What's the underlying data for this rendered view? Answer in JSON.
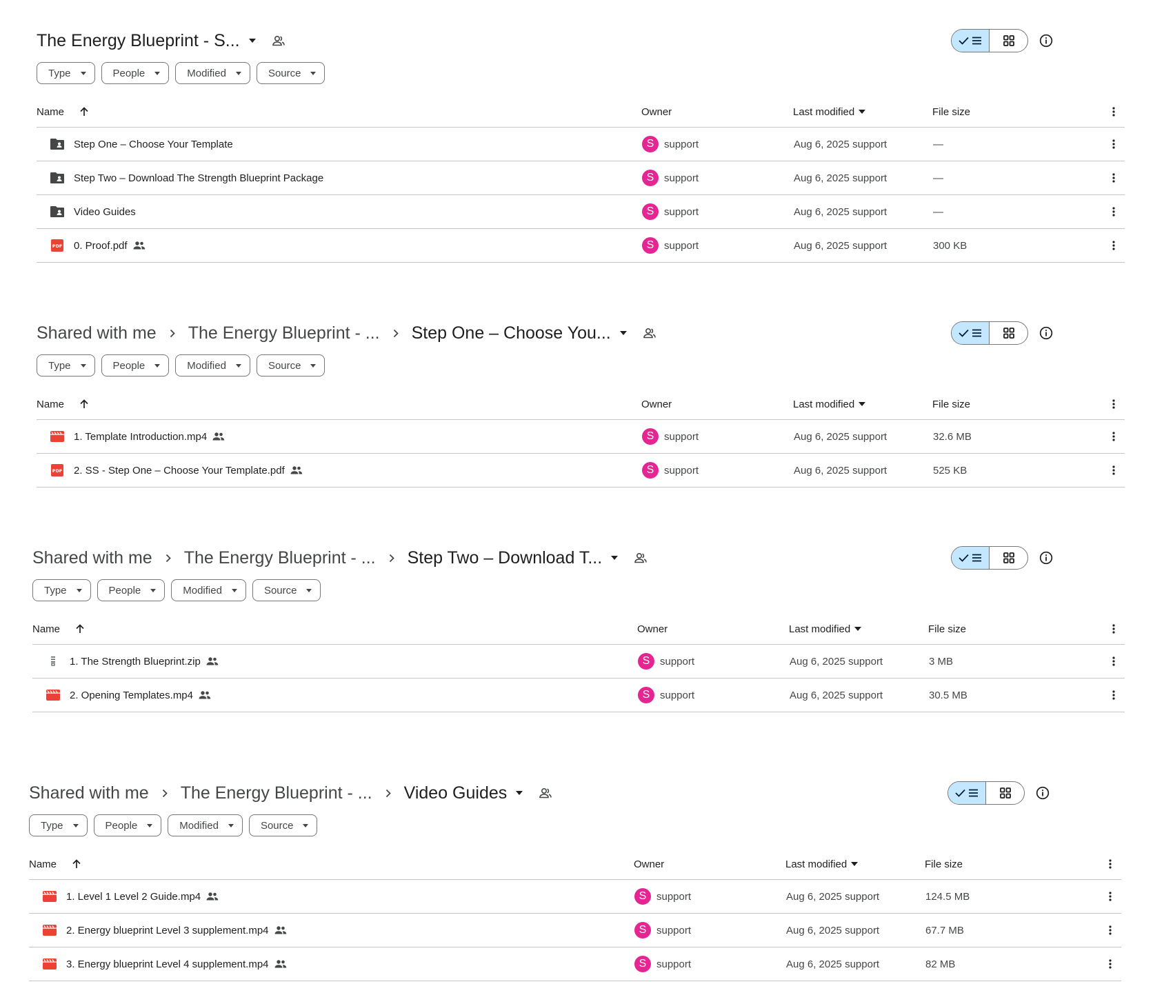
{
  "columns": {
    "name": "Name",
    "owner": "Owner",
    "last_modified": "Last modified",
    "file_size": "File size"
  },
  "filters": [
    "Type",
    "People",
    "Modified",
    "Source"
  ],
  "icons": {
    "folder": "shared-folder-icon",
    "pdf": "pdf-icon",
    "video": "video-icon",
    "zip": "zip-icon",
    "shared": "people-icon",
    "list_view": "list-view-icon",
    "grid_view": "grid-view-icon",
    "info": "info-icon",
    "more": "more-vert-icon"
  },
  "colors": {
    "avatar": "#e52592",
    "toggle_active": "#c2e7ff",
    "pdf": "#ea4335",
    "video": "#ea4335",
    "folder": "#444746"
  },
  "sections": [
    {
      "breadcrumbs": [],
      "current": "The Energy Blueprint - S...",
      "rows": [
        {
          "icon": "folder",
          "name": "Step One – Choose Your Template",
          "shared": false,
          "owner_initial": "S",
          "owner": "support",
          "modified": "Aug 6, 2025 support",
          "size": "—"
        },
        {
          "icon": "folder",
          "name": "Step Two – Download The Strength Blueprint Package",
          "shared": false,
          "owner_initial": "S",
          "owner": "support",
          "modified": "Aug 6, 2025 support",
          "size": "—"
        },
        {
          "icon": "folder",
          "name": "Video Guides",
          "shared": false,
          "owner_initial": "S",
          "owner": "support",
          "modified": "Aug 6, 2025 support",
          "size": "—"
        },
        {
          "icon": "pdf",
          "name": "0. Proof.pdf",
          "shared": true,
          "owner_initial": "S",
          "owner": "support",
          "modified": "Aug 6, 2025 support",
          "size": "300 KB"
        }
      ]
    },
    {
      "breadcrumbs": [
        "Shared with me",
        "The Energy Blueprint - ..."
      ],
      "current": "Step One – Choose You...",
      "rows": [
        {
          "icon": "video",
          "name": "1. Template Introduction.mp4",
          "shared": true,
          "owner_initial": "S",
          "owner": "support",
          "modified": "Aug 6, 2025 support",
          "size": "32.6 MB"
        },
        {
          "icon": "pdf",
          "name": "2. SS - Step One – Choose Your Template.pdf",
          "shared": true,
          "owner_initial": "S",
          "owner": "support",
          "modified": "Aug 6, 2025 support",
          "size": "525 KB"
        }
      ]
    },
    {
      "breadcrumbs": [
        "Shared with me",
        "The Energy Blueprint - ..."
      ],
      "current": "Step Two – Download T...",
      "rows": [
        {
          "icon": "zip",
          "name": "1. The Strength Blueprint.zip",
          "shared": true,
          "owner_initial": "S",
          "owner": "support",
          "modified": "Aug 6, 2025 support",
          "size": "3 MB"
        },
        {
          "icon": "video",
          "name": "2. Opening Templates.mp4",
          "shared": true,
          "owner_initial": "S",
          "owner": "support",
          "modified": "Aug 6, 2025 support",
          "size": "30.5 MB"
        }
      ]
    },
    {
      "breadcrumbs": [
        "Shared with me",
        "The Energy Blueprint - ..."
      ],
      "current": "Video Guides",
      "rows": [
        {
          "icon": "video",
          "name": "1. Level 1 Level 2 Guide.mp4",
          "shared": true,
          "owner_initial": "S",
          "owner": "support",
          "modified": "Aug 6, 2025 support",
          "size": "124.5 MB"
        },
        {
          "icon": "video",
          "name": "2. Energy blueprint Level 3 supplement.mp4",
          "shared": true,
          "owner_initial": "S",
          "owner": "support",
          "modified": "Aug 6, 2025 support",
          "size": "67.7 MB"
        },
        {
          "icon": "video",
          "name": "3. Energy blueprint Level 4 supplement.mp4",
          "shared": true,
          "owner_initial": "S",
          "owner": "support",
          "modified": "Aug 6, 2025 support",
          "size": "82 MB"
        }
      ]
    }
  ]
}
